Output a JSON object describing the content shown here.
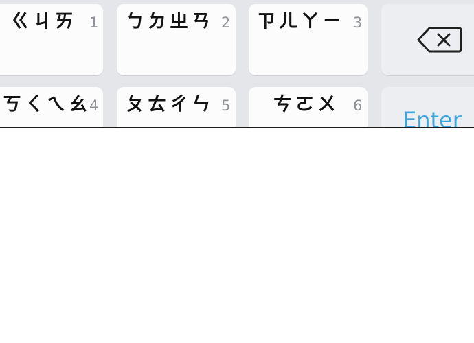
{
  "keyboard": {
    "row1": [
      {
        "glyphs": "ㄍㄐㄞ",
        "number": "1"
      },
      {
        "glyphs": "ㄅㄉㄓㄢ",
        "number": "2"
      },
      {
        "glyphs": "ㄗㄦㄚㄧ",
        "number": "3"
      }
    ],
    "row2": [
      {
        "glyphs": "ㄎㄑㄟㄠ",
        "number": "4"
      },
      {
        "glyphs": "ㄆㄊㄔㄣ",
        "number": "5"
      },
      {
        "glyphs": "ㄘㄛㄨ",
        "number": "6"
      }
    ],
    "enter_label": "Enter"
  },
  "icons": {
    "backspace": "backspace-icon"
  },
  "colors": {
    "key_background": "#fcfcfd",
    "function_key_background": "#eceef1",
    "keyboard_background": "#e4e6e9",
    "enter_text": "#3da5d9",
    "number_hint": "#8f9296"
  }
}
